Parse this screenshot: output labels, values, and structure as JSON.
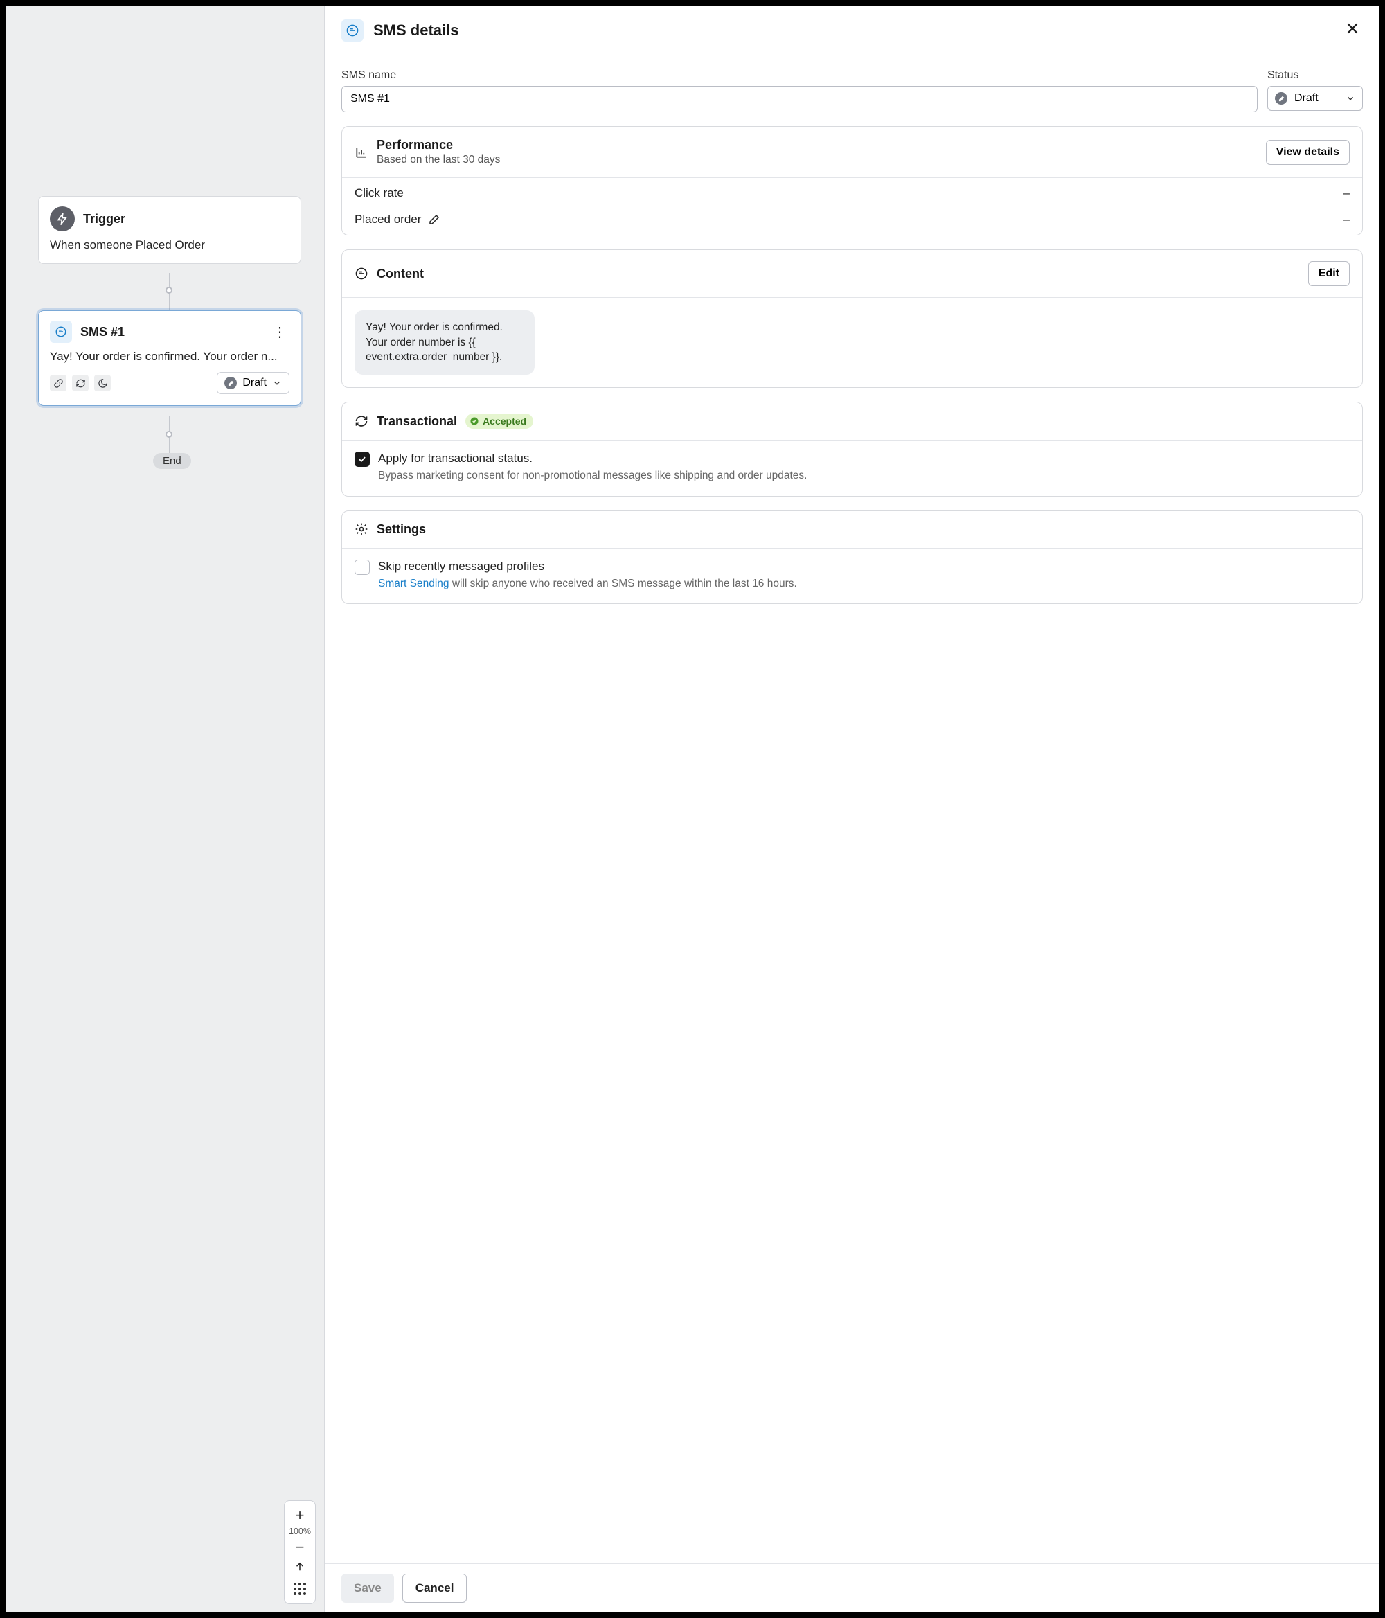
{
  "canvas": {
    "trigger": {
      "title": "Trigger",
      "desc": "When someone Placed Order"
    },
    "sms_node": {
      "title": "SMS #1",
      "preview": "Yay! Your order is confirmed. Your order n...",
      "status": "Draft"
    },
    "end_label": "End",
    "zoom": "100%"
  },
  "panel": {
    "title": "SMS details",
    "name_label": "SMS name",
    "name_value": "SMS #1",
    "status_label": "Status",
    "status_value": "Draft",
    "performance": {
      "title": "Performance",
      "subtitle": "Based on the last 30 days",
      "view_button": "View details",
      "metrics": [
        {
          "label": "Click rate",
          "value": "–"
        },
        {
          "label": "Placed order",
          "value": "–"
        }
      ]
    },
    "content": {
      "title": "Content",
      "edit_button": "Edit",
      "bubble": "Yay! Your order is confirmed. Your order number is {{ event.extra.order_number }}."
    },
    "transactional": {
      "title": "Transactional",
      "badge": "Accepted",
      "check_title": "Apply for transactional status.",
      "check_desc": "Bypass marketing consent for non-promotional messages like shipping and order updates."
    },
    "settings": {
      "title": "Settings",
      "skip_title": "Skip recently messaged profiles",
      "smart_link": "Smart Sending",
      "skip_desc_rest": " will skip anyone who received an SMS message within the last 16 hours."
    },
    "footer": {
      "save": "Save",
      "cancel": "Cancel"
    }
  }
}
